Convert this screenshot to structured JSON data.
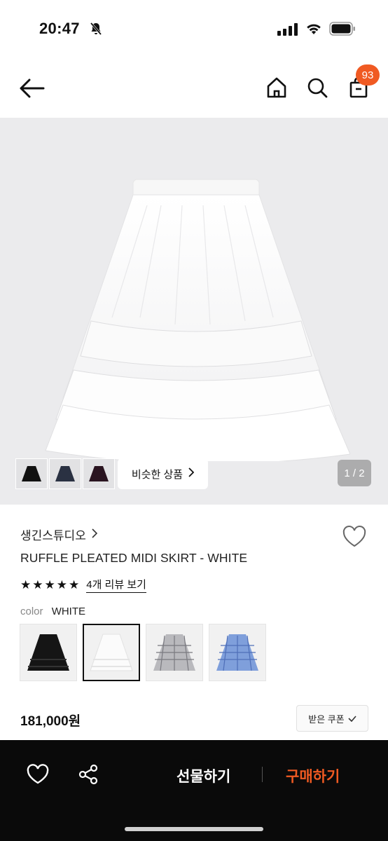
{
  "status_bar": {
    "time": "20:47"
  },
  "nav": {
    "cart_count": "93"
  },
  "hero": {
    "similar_label": "비슷한 상품",
    "pager": "1 / 2",
    "thumbs": [
      "black skirt",
      "navy skirt",
      "burgundy skirt"
    ]
  },
  "product": {
    "brand": "생긴스튜디오",
    "name": "RUFFLE PLEATED MIDI SKIRT - WHITE",
    "rating_stars": 5,
    "review_link": "4개 리뷰 보기",
    "color_label": "color",
    "color_value": "WHITE",
    "price": "181,000원",
    "coupon_label": "받은 쿠폰"
  },
  "bottom_bar": {
    "gift_label": "선물하기",
    "buy_label": "구매하기"
  },
  "colors": {
    "accent": "#f05a22",
    "bar": "#0a0a0a",
    "hero_bg": "#ebebed"
  }
}
